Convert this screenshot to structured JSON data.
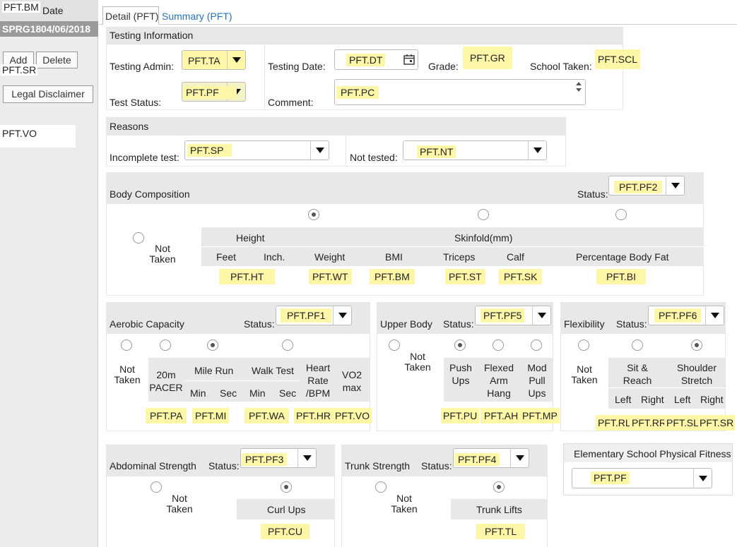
{
  "left_panel": {
    "overlay_tag": "PFT.BM",
    "date_header": "Date",
    "record_term": "SPRG18",
    "record_date": "04/06/2018",
    "add_label": "Add",
    "delete_label": "Delete",
    "sr_tag": "PFT.SR",
    "legal_label": "Legal Disclaimer",
    "vo_tag": "PFT.VO"
  },
  "tabs": [
    {
      "label": "Detail (PFT)",
      "active": true
    },
    {
      "label": "Summary (PFT)",
      "active": false
    }
  ],
  "testing_info": {
    "header": "Testing Information",
    "admin_label": "Testing Admin:",
    "admin_value": "PFT.TA",
    "date_label": "Testing Date:",
    "date_value": "PFT.DT",
    "grade_label": "Grade:",
    "grade_value": "PFT.GR",
    "school_label": "School Taken:",
    "school_value": "PFT.SCL",
    "status_label": "Test Status:",
    "status_value": "PFT.PF",
    "comment_label": "Comment:",
    "comment_value": "PFT.PC"
  },
  "reasons": {
    "header": "Reasons",
    "incomplete_label": "Incomplete test:",
    "incomplete_value": "PFT.SP",
    "not_tested_label": "Not tested:",
    "not_tested_value": "PFT.NT"
  },
  "body_comp": {
    "header": "Body Composition",
    "status_label": "Status:",
    "status_value": "PFT.PF2",
    "not_taken": "Not Taken",
    "height": "Height",
    "skinfold": "Skinfold(mm)",
    "feet": "Feet",
    "inch": "Inch.",
    "weight": "Weight",
    "bmi": "BMI",
    "triceps": "Triceps",
    "calf": "Calf",
    "pbf": "Percentage Body Fat",
    "ht": "PFT.HT",
    "wt": "PFT.WT",
    "bm": "PFT.BM",
    "st": "PFT.ST",
    "sk": "PFT.SK",
    "bi": "PFT.BI"
  },
  "aerobic": {
    "header": "Aerobic Capacity",
    "status_label": "Status:",
    "status_value": "PFT.PF1",
    "not_taken": "Not Taken",
    "pacer": "20m PACER",
    "mile_run": "Mile Run",
    "walk_test": "Walk Test",
    "heart_rate": "Heart Rate /BPM",
    "vo2": "VO2 max",
    "min": "Min",
    "sec": "Sec",
    "pa": "PFT.PA",
    "mi": "PFT.MI",
    "wa": "PFT.WA",
    "hr": "PFT.HR",
    "vo": "PFT.VO"
  },
  "upper_body": {
    "header": "Upper Body",
    "status_label": "Status:",
    "status_value": "PFT.PF5",
    "not_taken": "Not Taken",
    "push": "Push Ups",
    "flexed": "Flexed Arm Hang",
    "mod": "Mod Pull Ups",
    "pu": "PFT.PU",
    "ah": "PFT.AH",
    "mp": "PFT.MP"
  },
  "flexibility": {
    "header": "Flexibility",
    "status_label": "Status:",
    "status_value": "PFT.PF6",
    "not_taken": "Not Taken",
    "sit_reach": "Sit & Reach",
    "shoulder": "Shoulder Stretch",
    "left": "Left",
    "right": "Right",
    "rl": "PFT.RL",
    "rr": "PFT.RR",
    "sl": "PFT.SL",
    "sr": "PFT.SR"
  },
  "abdominal": {
    "header": "Abdominal Strength",
    "status_label": "Status:",
    "status_value": "PFT.PF3",
    "not_taken": "Not Taken",
    "curl": "Curl Ups",
    "cu": "PFT.CU"
  },
  "trunk": {
    "header": "Trunk Strength",
    "status_label": "Status:",
    "status_value": "PFT.PF4",
    "not_taken": "Not Taken",
    "lifts": "Trunk Lifts",
    "tl": "PFT.TL"
  },
  "elementary": {
    "header": "Elementary School Physical Fitness",
    "value": "PFT.PF"
  }
}
